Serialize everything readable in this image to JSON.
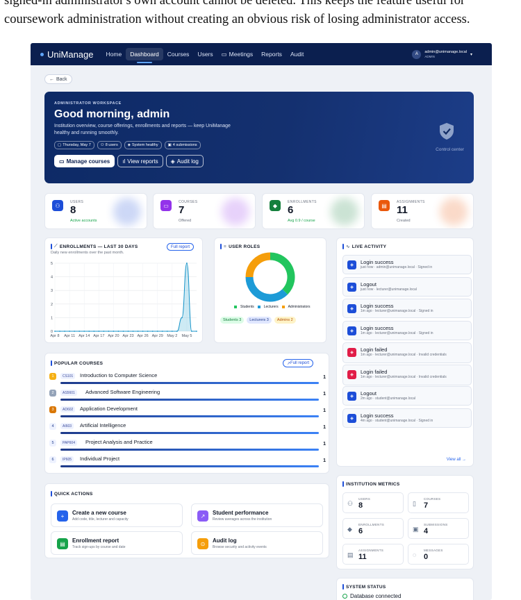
{
  "doc": {
    "line1": "signed-in administrator's own account cannot be deleted. This keeps the feature useful for",
    "line2": "coursework administration without creating an obvious risk of losing administrator access."
  },
  "nav": {
    "brand": "UniManage",
    "items": [
      "Home",
      "Dashboard",
      "Courses",
      "Users",
      "Meetings",
      "Reports",
      "Audit"
    ],
    "active": "Dashboard",
    "user_initial": "A",
    "user_email": "admin@unimanage.local",
    "user_role": "ADMIN"
  },
  "back": "Back",
  "hero": {
    "eyebrow": "ADMINISTRATOR WORKSPACE",
    "title": "Good morning, admin",
    "subtitle": "Institution overview, course offerings, enrollments and reports — keep UniManage healthy and running smoothly.",
    "chips": [
      "Thursday, May 7",
      "8 users",
      "System healthy",
      "4 submissions"
    ],
    "buttons": [
      "Manage courses",
      "View reports",
      "Audit log"
    ],
    "control": "Control center"
  },
  "stats": [
    {
      "label": "USERS",
      "value": "8",
      "foot": "Active accounts",
      "color": "#1d4ed8",
      "foot_color": "#16a34a"
    },
    {
      "label": "COURSES",
      "value": "7",
      "foot": "Offered",
      "color": "#9333ea",
      "foot_color": "#6b7280"
    },
    {
      "label": "ENROLLMENTS",
      "value": "6",
      "foot": "Avg 0.9 / course",
      "color": "#15803d",
      "foot_color": "#16a34a"
    },
    {
      "label": "ASSIGNMENTS",
      "value": "11",
      "foot": "Created",
      "color": "#ea580c",
      "foot_color": "#6b7280"
    }
  ],
  "enroll": {
    "title": "ENROLLMENTS — LAST 30 DAYS",
    "subtitle": "Daily new enrollments over the past month.",
    "button": "Full report"
  },
  "chart_data": {
    "type": "area",
    "x": [
      "Apr 8",
      "Apr 9",
      "Apr 10",
      "Apr 11",
      "Apr 12",
      "Apr 13",
      "Apr 14",
      "Apr 15",
      "Apr 16",
      "Apr 17",
      "Apr 18",
      "Apr 19",
      "Apr 20",
      "Apr 21",
      "Apr 22",
      "Apr 23",
      "Apr 24",
      "Apr 25",
      "Apr 26",
      "Apr 27",
      "Apr 28",
      "Apr 29",
      "Apr 30",
      "May 1",
      "May 2",
      "May 3",
      "May 4",
      "May 5",
      "May 6",
      "May 7"
    ],
    "values": [
      0,
      0,
      0,
      0,
      0,
      0,
      0,
      0,
      0,
      0,
      0,
      0,
      0,
      0,
      0,
      0,
      0,
      0,
      0,
      0,
      0,
      0,
      0,
      0,
      0,
      0,
      1,
      5,
      0,
      0
    ],
    "x_ticks": [
      "Apr 8",
      "Apr 11",
      "Apr 14",
      "Apr 17",
      "Apr 20",
      "Apr 23",
      "Apr 26",
      "Apr 29",
      "May 2",
      "May 5"
    ],
    "y_ticks": [
      "0",
      "1",
      "2",
      "3",
      "4",
      "5"
    ],
    "ylim": [
      0,
      5
    ],
    "grid": true
  },
  "roles": {
    "title": "USER ROLES",
    "legend": [
      "Students",
      "Lecturers",
      "Administrators"
    ],
    "badges": [
      "Students 3",
      "Lecturers 3",
      "Admins 2"
    ],
    "values": [
      3,
      3,
      2
    ],
    "colors": [
      "#22c55e",
      "#1d9bd7",
      "#f59e0b"
    ]
  },
  "activity": {
    "title": "LIVE ACTIVITY",
    "items": [
      {
        "title": "Login success",
        "meta": "just now · admin@unimanage.local · Signed in",
        "kind": "ok"
      },
      {
        "title": "Logout",
        "meta": "just now · lecturer@unimanage.local",
        "kind": "ok"
      },
      {
        "title": "Login success",
        "meta": "1m ago · lecturer@unimanage.local · Signed in",
        "kind": "ok"
      },
      {
        "title": "Login success",
        "meta": "1m ago · lecturer@unimanage.local · Signed in",
        "kind": "ok"
      },
      {
        "title": "Login failed",
        "meta": "1m ago · lecturer@unimanage.local · Invalid credentials",
        "kind": "fail"
      },
      {
        "title": "Login failed",
        "meta": "1m ago · lecturer@unimanage.local · Invalid credentials",
        "kind": "fail"
      },
      {
        "title": "Logout",
        "meta": "2m ago · student@unimanage.local",
        "kind": "ok"
      },
      {
        "title": "Login success",
        "meta": "4m ago · student@unimanage.local · Signed in",
        "kind": "ok"
      }
    ],
    "view_all": "View all →"
  },
  "popular": {
    "title": "POPULAR COURSES",
    "button": "Full report",
    "rows": [
      {
        "rank": "1",
        "code": "CS101",
        "name": "Introduction to Computer Science",
        "count": "1",
        "color": "#f5b014"
      },
      {
        "rank": "2",
        "code": "AS5601",
        "name": "Advanced Software Engineering",
        "count": "1",
        "color": "#94a3b8"
      },
      {
        "rank": "3",
        "code": "AD602",
        "name": "Application Development",
        "count": "1",
        "color": "#d97706"
      },
      {
        "rank": "4",
        "code": "AI603",
        "name": "Artificial Intelligence",
        "count": "1",
        "color": "#eef2ff"
      },
      {
        "rank": "5",
        "code": "PAP604",
        "name": "Project Analysis and Practice",
        "count": "1",
        "color": "#eef2ff"
      },
      {
        "rank": "6",
        "code": "IP605",
        "name": "Individual Project",
        "count": "1",
        "color": "#eef2ff"
      }
    ]
  },
  "quick": {
    "title": "QUICK ACTIONS",
    "items": [
      {
        "title": "Create a new course",
        "sub": "Add code, title, lecturer and capacity",
        "color": "#2563eb",
        "icon": "+"
      },
      {
        "title": "Student performance",
        "sub": "Review averages across the institution",
        "color": "#8b5cf6",
        "icon": "↗"
      },
      {
        "title": "Enrollment report",
        "sub": "Track sign-ups by course and date",
        "color": "#16a34a",
        "icon": "▤"
      },
      {
        "title": "Audit log",
        "sub": "Browse security and activity events",
        "color": "#f59e0b",
        "icon": "⊙"
      }
    ]
  },
  "metrics": {
    "title": "INSTITUTION METRICS",
    "items": [
      {
        "label": "USERS",
        "value": "8",
        "icon": "users-icon"
      },
      {
        "label": "COURSES",
        "value": "7",
        "icon": "book-icon"
      },
      {
        "label": "ENROLLMENTS",
        "value": "6",
        "icon": "cap-icon"
      },
      {
        "label": "SUBMISSIONS",
        "value": "4",
        "icon": "clipboard-icon"
      },
      {
        "label": "ASSIGNMENTS",
        "value": "11",
        "icon": "document-icon"
      },
      {
        "label": "MESSAGES",
        "value": "0",
        "icon": "chat-icon"
      }
    ]
  },
  "system": {
    "title": "SYSTEM STATUS",
    "item": "Database connected"
  }
}
